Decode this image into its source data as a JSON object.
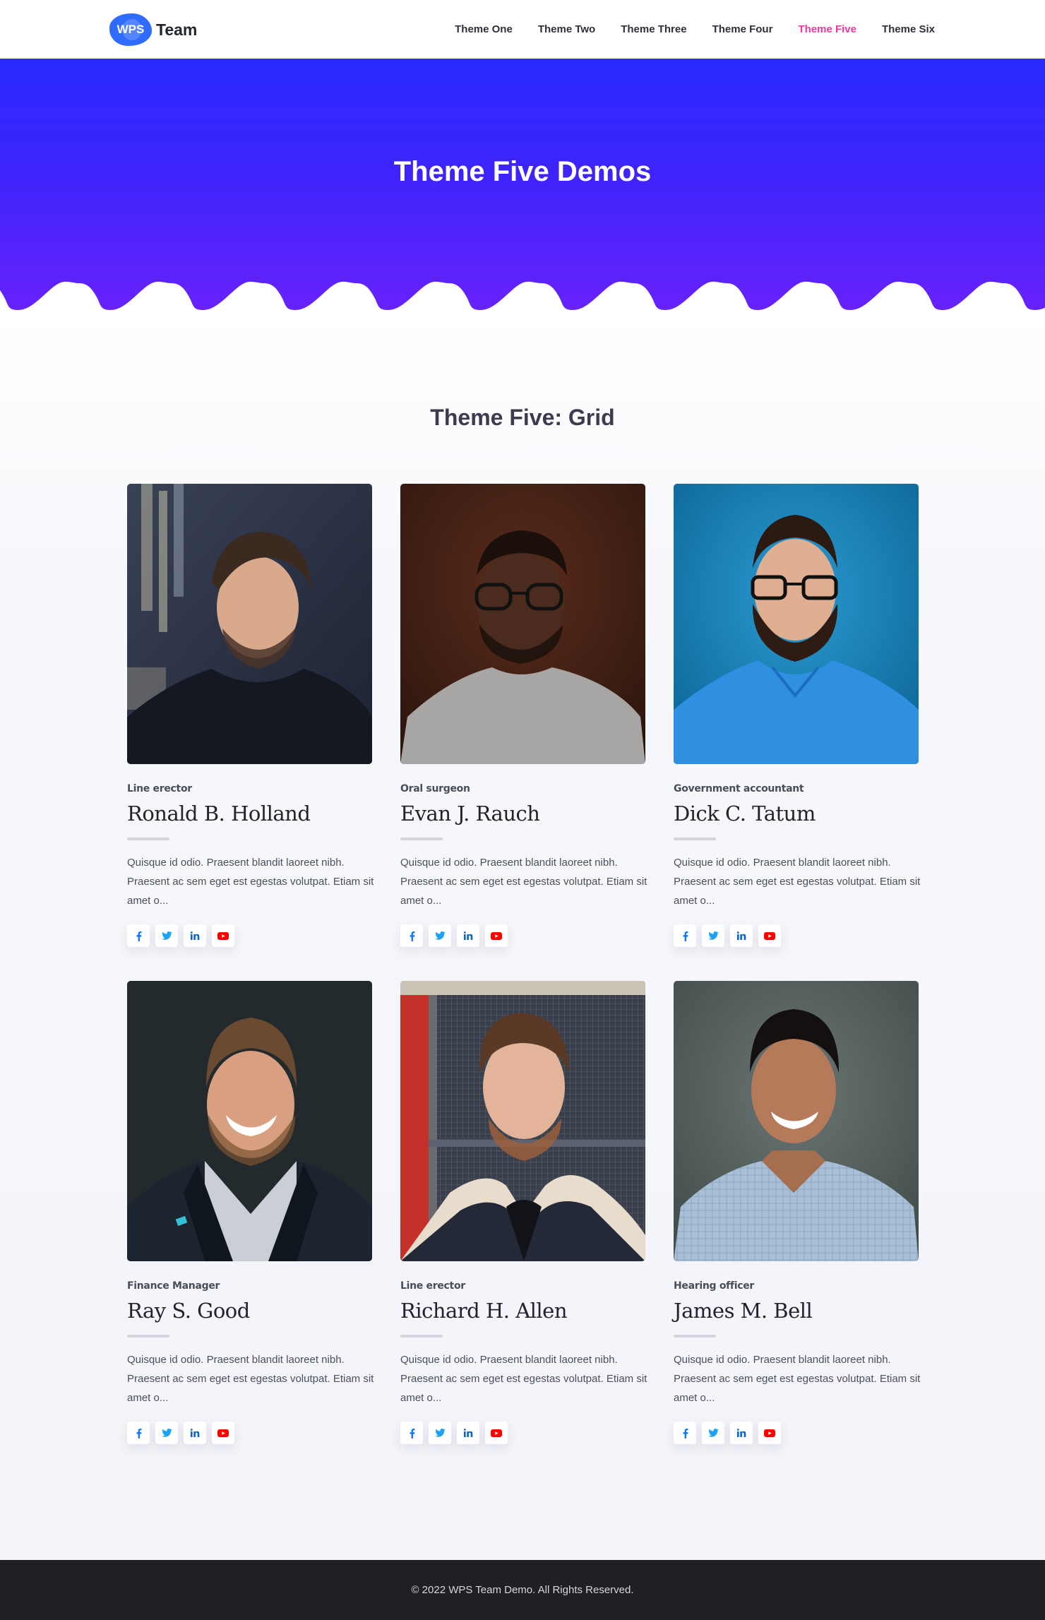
{
  "header": {
    "logo_badge": "WPS",
    "logo_text": "Team",
    "nav": [
      {
        "label": "Theme One",
        "active": false
      },
      {
        "label": "Theme Two",
        "active": false
      },
      {
        "label": "Theme Three",
        "active": false
      },
      {
        "label": "Theme Four",
        "active": false
      },
      {
        "label": "Theme Five",
        "active": true
      },
      {
        "label": "Theme Six",
        "active": false
      }
    ]
  },
  "colors": {
    "accent": "#f2359d",
    "logo_blue": "#2f6bff",
    "hero_top": "#2a2bff",
    "hero_bottom": "#6822fd",
    "footer_bg": "#1f2024",
    "facebook": "#1877f2",
    "twitter": "#1da1f2",
    "linkedin": "#0a66c2",
    "youtube": "#ff0000"
  },
  "hero": {
    "title": "Theme Five Demos"
  },
  "section": {
    "title": "Theme Five: Grid"
  },
  "members": [
    {
      "role": "Line erector",
      "name": "Ronald B. Holland",
      "bio": "Quisque id odio. Praesent blandit laoreet nibh. Praesent ac sem eget est egestas volutpat. Etiam sit amet o...",
      "photo": "portrait-man-dark-hoodie"
    },
    {
      "role": "Oral surgeon",
      "name": "Evan J. Rauch",
      "bio": "Quisque id odio. Praesent blandit laoreet nibh. Praesent ac sem eget est egestas volutpat. Etiam sit amet o...",
      "photo": "portrait-man-glasses-grey-sweater"
    },
    {
      "role": "Government accountant",
      "name": "Dick C. Tatum",
      "bio": "Quisque id odio. Praesent blandit laoreet nibh. Praesent ac sem eget est egestas volutpat. Etiam sit amet o...",
      "photo": "portrait-man-beard-blue-shirt"
    },
    {
      "role": "Finance Manager",
      "name": "Ray S. Good",
      "bio": "Quisque id odio. Praesent blandit laoreet nibh. Praesent ac sem eget est egestas volutpat. Etiam sit amet o...",
      "photo": "portrait-man-smiling-dark-jacket"
    },
    {
      "role": "Line erector",
      "name": "Richard H. Allen",
      "bio": "Quisque id odio. Praesent blandit laoreet nibh. Praesent ac sem eget est egestas volutpat. Etiam sit amet o...",
      "photo": "portrait-man-sherpa-jacket"
    },
    {
      "role": "Hearing officer",
      "name": "James M. Bell",
      "bio": "Quisque id odio. Praesent blandit laoreet nibh. Praesent ac sem eget est egestas volutpat. Etiam sit amet o...",
      "photo": "portrait-man-smiling-checked-shirt"
    }
  ],
  "social_icons": [
    "facebook-icon",
    "twitter-icon",
    "linkedin-icon",
    "youtube-icon"
  ],
  "footer": {
    "copyright": "© 2022 WPS Team Demo. All Rights Reserved."
  }
}
